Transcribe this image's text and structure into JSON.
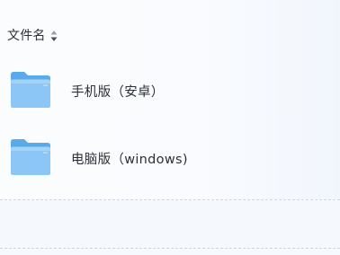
{
  "list_header": {
    "column_label": "文件名",
    "sort_icon": "sort-updown-icon"
  },
  "files": [
    {
      "name": "手机版（安卓）",
      "icon": "folder-icon"
    },
    {
      "name": "电脑版（windows)",
      "icon": "folder-icon"
    }
  ],
  "colors": {
    "folder_front": "#8cc6f6",
    "folder_back": "#5aa9ea",
    "background": "#f6f9fd"
  }
}
